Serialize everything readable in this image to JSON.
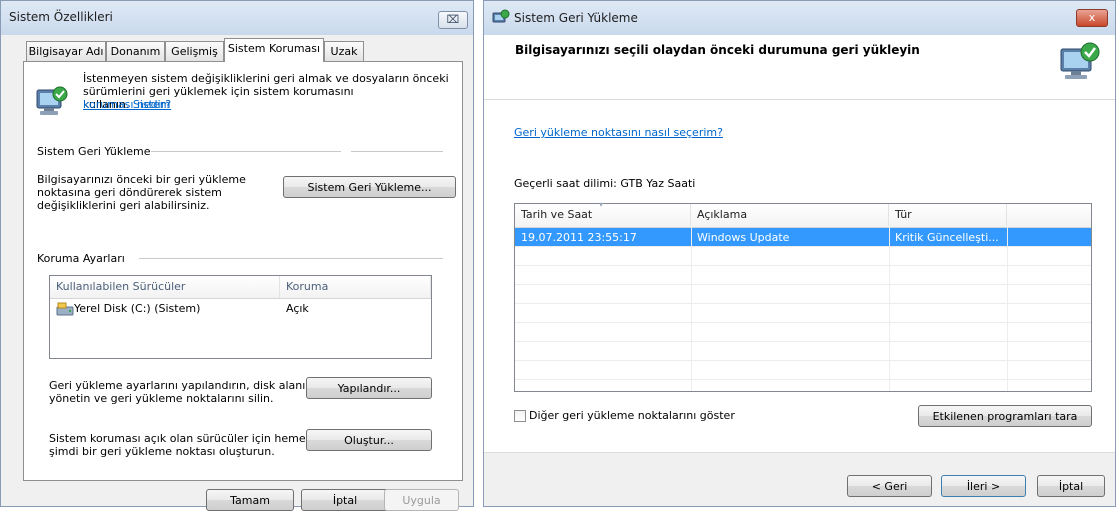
{
  "left_dialog": {
    "title": "Sistem Özellikleri",
    "close_label": "⌧",
    "tabs": [
      "Bilgisayar Adı",
      "Donanım",
      "Gelişmiş",
      "Sistem Koruması",
      "Uzak"
    ],
    "intro_text_line1": "İstenmeyen sistem değişikliklerini geri almak ve dosyaların önceki",
    "intro_text_line2": "sürümlerini geri yüklemek için sistem korumasını kullanın.",
    "intro_link_part1": "Sistem",
    "intro_link_part2": "koruması nedir?",
    "restore_group_title": "Sistem Geri Yükleme",
    "restore_text_line1": "Bilgisayarınızı önceki bir geri yükleme",
    "restore_text_line2": "noktasına geri döndürerek sistem",
    "restore_text_line3": "değişikliklerini geri alabilirsiniz.",
    "restore_button": "Sistem Geri Yükleme...",
    "protection_group_title": "Koruma Ayarları",
    "drives_header": "Kullanılabilen Sürücüler",
    "protection_header": "Koruma",
    "drives": [
      {
        "name": "Yerel Disk (C:) (Sistem)",
        "protection": "Açık"
      }
    ],
    "configure_text_line1": "Geri yükleme ayarlarını yapılandırın, disk alanını",
    "configure_text_line2": "yönetin ve geri yükleme noktalarını silin.",
    "configure_button": "Yapılandır...",
    "create_text_line1": "Sistem koruması açık olan sürücüler için hemen",
    "create_text_line2": "şimdi bir geri yükleme noktası oluşturun.",
    "create_button": "Oluştur...",
    "ok_button": "Tamam",
    "cancel_button": "İptal",
    "apply_button": "Uygula"
  },
  "right_dialog": {
    "title": "Sistem Geri Yükleme",
    "close_label": "x",
    "heading": "Bilgisayarınızı seçili olaydan önceki durumuna geri yükleyin",
    "help_link": "Geri yükleme noktasını nasıl seçerim?",
    "timezone": "Geçerli saat dilimi: GTB Yaz Saati",
    "columns": [
      "Tarih ve Saat",
      "Açıklama",
      "Tür"
    ],
    "rows": [
      {
        "date": "19.07.2011 23:55:17",
        "description": "Windows Update",
        "type": "Kritik Güncelleşti..."
      }
    ],
    "show_more_label": "Diğer geri yükleme noktalarını göster",
    "scan_button": "Etkilenen programları tara",
    "back_button": "< Geri",
    "next_button": "İleri >",
    "cancel_button": "İptal"
  }
}
